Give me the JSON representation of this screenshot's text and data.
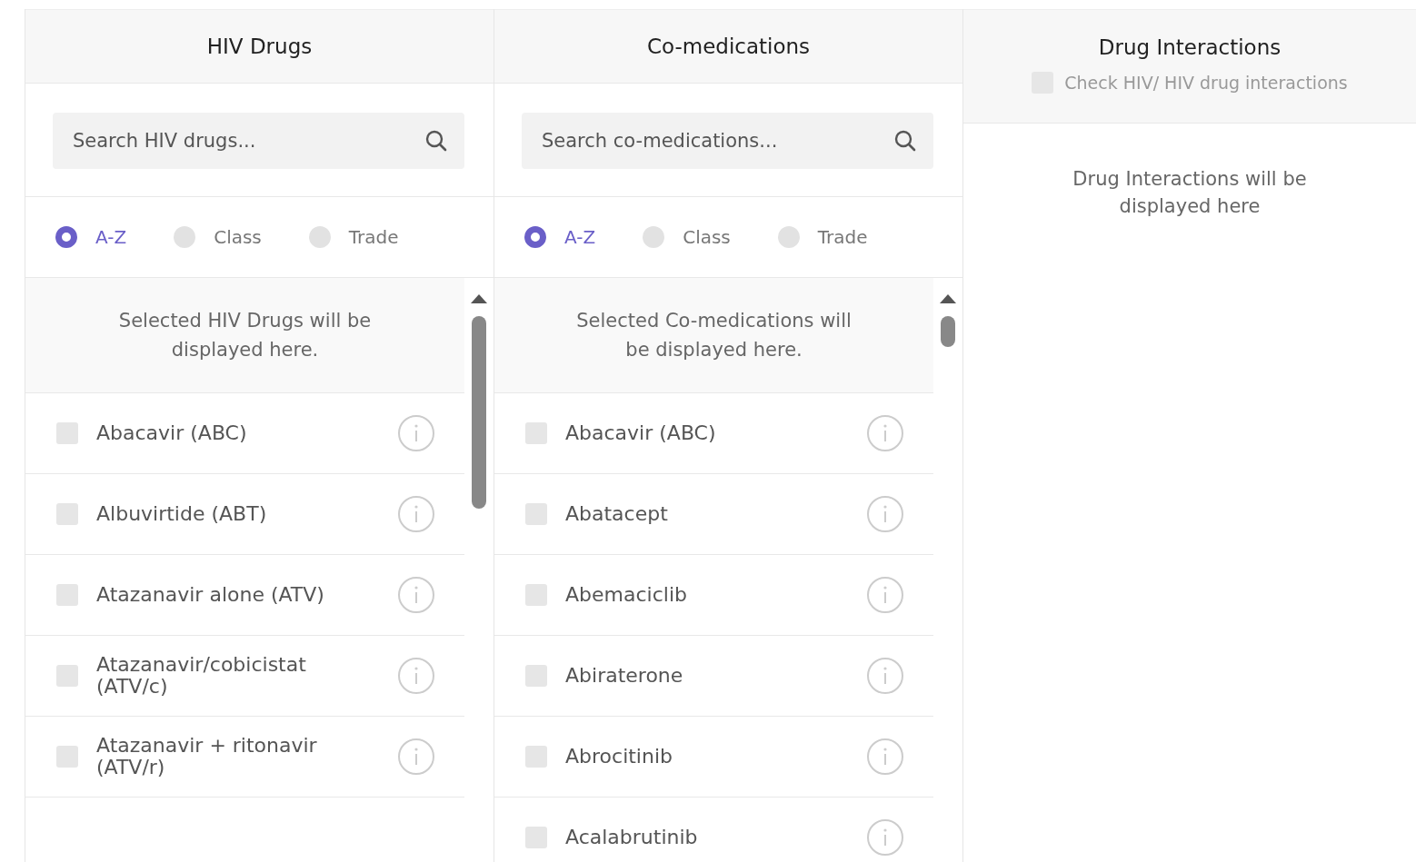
{
  "columns": [
    {
      "title": "HIV Drugs",
      "search": {
        "placeholder": "Search HIV drugs..."
      },
      "sort_options": [
        {
          "label": "A-Z",
          "selected": true
        },
        {
          "label": "Class",
          "selected": false
        },
        {
          "label": "Trade",
          "selected": false
        }
      ],
      "selected_message": "Selected HIV Drugs will be displayed here.",
      "drugs": [
        {
          "name": "Abacavir (ABC)",
          "checked": false
        },
        {
          "name": "Albuvirtide (ABT)",
          "checked": false
        },
        {
          "name": "Atazanavir alone (ATV)",
          "checked": false
        },
        {
          "name": "Atazanavir/cobicistat (ATV/c)",
          "checked": false
        },
        {
          "name": "Atazanavir + ritonavir (ATV/r)",
          "checked": false
        }
      ]
    },
    {
      "title": "Co-medications",
      "search": {
        "placeholder": "Search co-medications..."
      },
      "sort_options": [
        {
          "label": "A-Z",
          "selected": true
        },
        {
          "label": "Class",
          "selected": false
        },
        {
          "label": "Trade",
          "selected": false
        }
      ],
      "selected_message": "Selected Co-medications will be displayed here.",
      "drugs": [
        {
          "name": "Abacavir (ABC)",
          "checked": false
        },
        {
          "name": "Abatacept",
          "checked": false
        },
        {
          "name": "Abemaciclib",
          "checked": false
        },
        {
          "name": "Abiraterone",
          "checked": false
        },
        {
          "name": "Abrocitinib",
          "checked": false
        },
        {
          "name": "Acalabrutinib",
          "checked": false
        }
      ]
    }
  ],
  "interactions": {
    "title": "Drug Interactions",
    "check_option": {
      "label": "Check HIV/ HIV drug interactions",
      "checked": false
    },
    "message": "Drug Interactions will be displayed here"
  }
}
